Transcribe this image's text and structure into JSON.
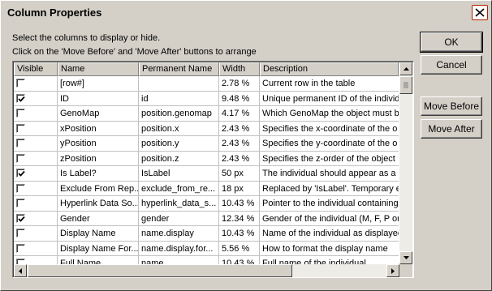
{
  "window": {
    "title": "Column Properties"
  },
  "instructions": {
    "line1": "Select the columns to display or hide.",
    "line2": "Click on the 'Move Before' and 'Move After' buttons to arrange"
  },
  "columns": [
    "Visible",
    "Name",
    "Permanent Name",
    "Width",
    "Description"
  ],
  "rows": [
    {
      "visible": false,
      "name": "[row#]",
      "permanent": "",
      "width": "2.78 %",
      "description": "Current row in the table"
    },
    {
      "visible": true,
      "name": "ID",
      "permanent": "id",
      "width": "9.48 %",
      "description": "Unique permanent ID of the individual"
    },
    {
      "visible": false,
      "name": "GenoMap",
      "permanent": "position.genomap",
      "width": "4.17 %",
      "description": "Which GenoMap the object must be"
    },
    {
      "visible": false,
      "name": "xPosition",
      "permanent": "position.x",
      "width": "2.43 %",
      "description": "Specifies the x-coordinate of the o"
    },
    {
      "visible": false,
      "name": "yPosition",
      "permanent": "position.y",
      "width": "2.43 %",
      "description": "Specifies the y-coordinate of the o"
    },
    {
      "visible": false,
      "name": "zPosition",
      "permanent": "position.z",
      "width": "2.43 %",
      "description": "Specifies the z-order of the object"
    },
    {
      "visible": true,
      "name": "Is Label?",
      "permanent": "IsLabel",
      "width": "50 px",
      "description": "The individual should appear as a l"
    },
    {
      "visible": false,
      "name": "Exclude From Rep...",
      "permanent": "exclude_from_re...",
      "width": "18 px",
      "description": "Replaced by 'IsLabel'. Temporary e"
    },
    {
      "visible": false,
      "name": "Hyperlink Data So...",
      "permanent": "hyperlink_data_s...",
      "width": "10.43 %",
      "description": "Pointer to the individual containing t"
    },
    {
      "visible": true,
      "name": "Gender",
      "permanent": "gender",
      "width": "12.34 %",
      "description": "Gender of the individual (M, F, P or"
    },
    {
      "visible": false,
      "name": "Display Name",
      "permanent": "name.display",
      "width": "10.43 %",
      "description": "Name of the individual as displayed"
    },
    {
      "visible": false,
      "name": "Display Name For...",
      "permanent": "name.display.for...",
      "width": "5.56 %",
      "description": "How to format the display name"
    },
    {
      "visible": false,
      "name": "Full Name",
      "permanent": "name",
      "width": "10.43 %",
      "description": "Full name of the individual"
    }
  ],
  "buttons": {
    "ok": "OK",
    "cancel": "Cancel",
    "move_before": "Move Before",
    "move_after": "Move After"
  }
}
